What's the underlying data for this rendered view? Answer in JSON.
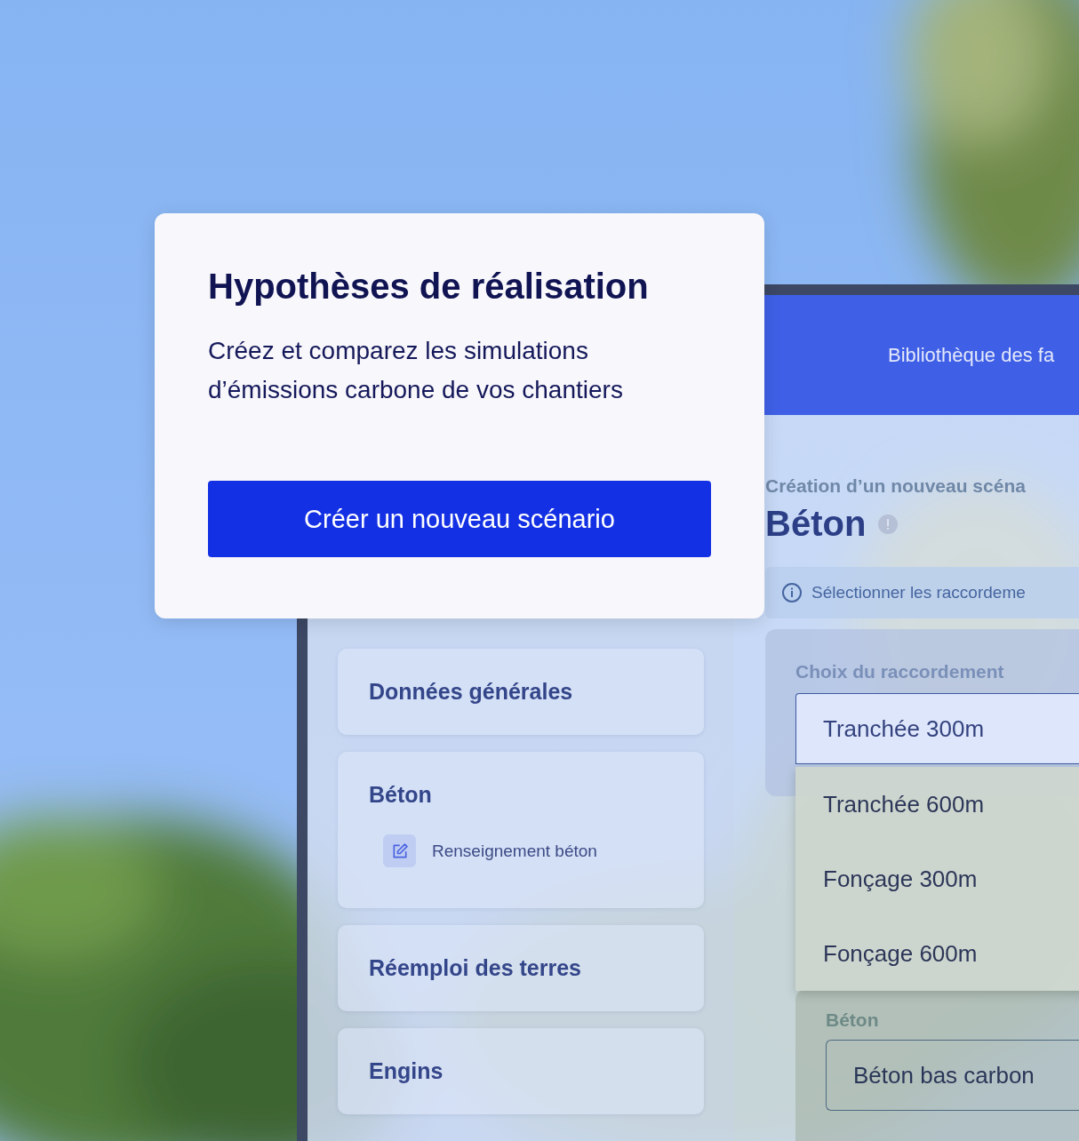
{
  "hero_card": {
    "title": "Hypothèses de réalisation",
    "description": "Créez et comparez les simulations d’émissions carbone de vos chantiers",
    "button": "Créer un nouveau scénario"
  },
  "window": {
    "nav": [
      "Bibliothèque des fa"
    ],
    "sidebar": {
      "items": [
        {
          "label": "Données générales"
        },
        {
          "label": "Béton",
          "children": [
            {
              "label": "Renseignement béton"
            }
          ]
        },
        {
          "label": "Réemploi des terres"
        },
        {
          "label": "Engins"
        }
      ]
    },
    "main": {
      "subtitle": "Création d’un nouveau scéna",
      "title": "Béton",
      "info": "Sélectionner les raccordeme",
      "connection": {
        "label": "Choix du raccordement",
        "value": "Tranchée 300m",
        "open": true,
        "options": [
          "Tranchée 600m",
          "Fonçage 300m",
          "Fonçage 600m"
        ]
      },
      "concrete": {
        "label": "Béton",
        "value": "Béton bas carbon"
      }
    }
  }
}
